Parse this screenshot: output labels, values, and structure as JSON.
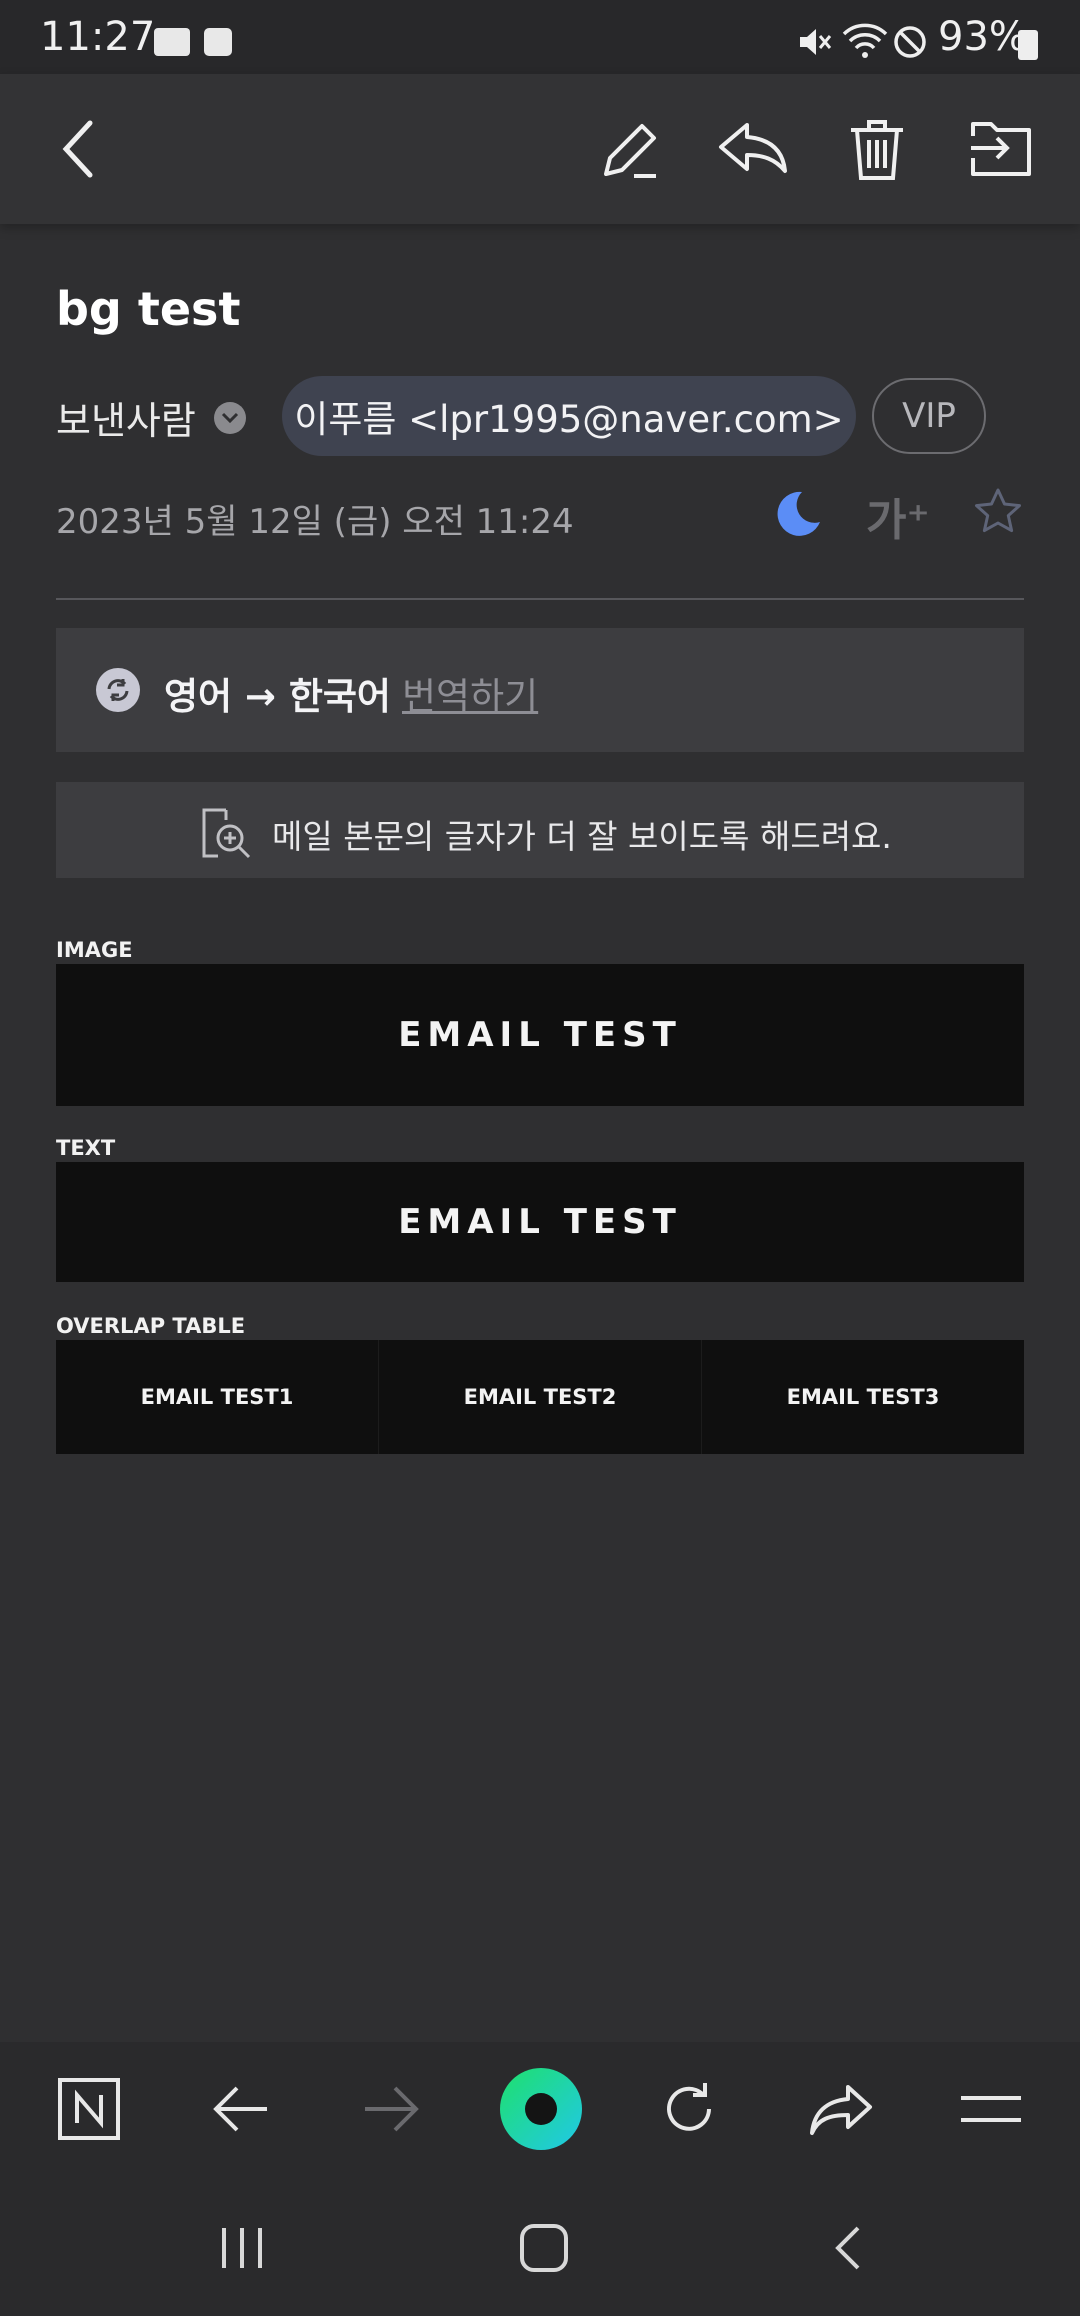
{
  "status": {
    "time": "11:27",
    "battery": "93%"
  },
  "toolbar": {
    "icons": [
      "back-icon",
      "pencil-icon",
      "reply-icon",
      "trash-icon",
      "move-folder-icon"
    ]
  },
  "email": {
    "subject": "bg test",
    "sender_label": "보낸사람",
    "sender": "이푸름 <lpr1995@naver.com>",
    "vip": "VIP",
    "date": "2023년 5월 12일 (금) 오전 11:24",
    "font_size_button": "가⁺"
  },
  "translate": {
    "languages": "영어 → 한국어",
    "action": "번역하기"
  },
  "zoom_banner": {
    "text": "메일 본문의 글자가 더 잘 보이도록 해드려요."
  },
  "content": {
    "image_label": "IMAGE",
    "image_text": "EMAIL TEST",
    "text_label": "TEXT",
    "text_text": "EMAIL TEST",
    "table_label": "OVERLAP TABLE",
    "table_cells": [
      "EMAIL TEST1",
      "EMAIL TEST2",
      "EMAIL TEST3"
    ]
  },
  "colors": {
    "accent": "#3ee6a0",
    "moon": "#5b8df6",
    "background": "#2f2f31"
  }
}
